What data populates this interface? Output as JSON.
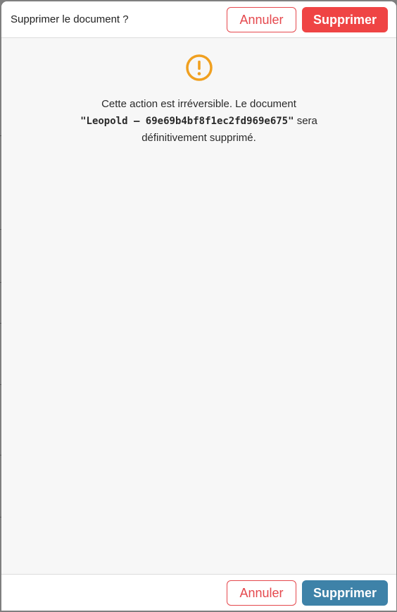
{
  "dialog": {
    "title": "Supprimer le document ?",
    "cancel_label": "Annuler",
    "delete_label": "Supprimer"
  },
  "message": {
    "before": "Cette action est irréversible. Le document",
    "document_name": "\"Leopold – 69e69b4bf8f1ec2fd969e675\"",
    "after": "sera définitivement supprimé."
  },
  "icons": {
    "warning": "warning-circle-icon"
  },
  "colors": {
    "danger": "#ef4444",
    "primary": "#3e82a8",
    "warning": "#f0a020"
  }
}
